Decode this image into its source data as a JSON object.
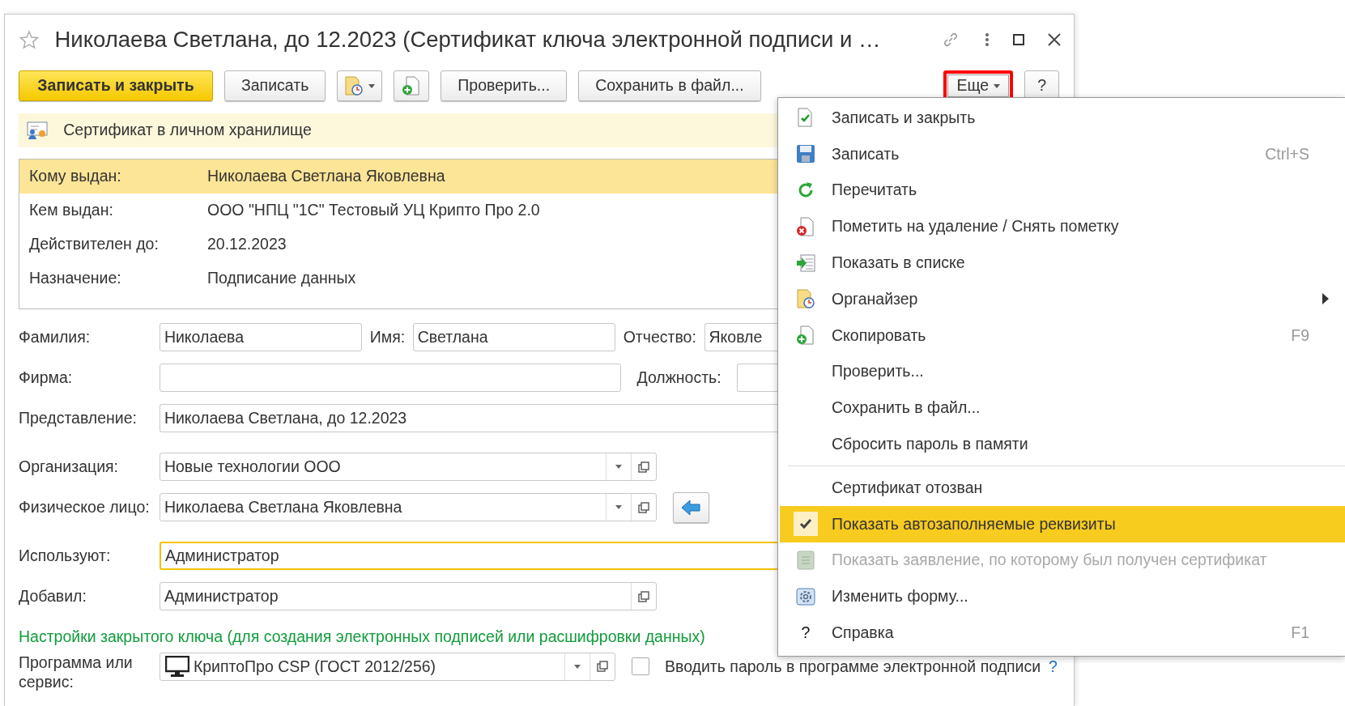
{
  "window": {
    "title": "Николаева Светлана, до 12.2023 (Сертификат ключа электронной подписи и …"
  },
  "toolbar": [
    {
      "kind": "primary",
      "label": "Записать и закрыть",
      "highlighted": false
    },
    {
      "kind": "text",
      "label": "Записать",
      "highlighted": false
    },
    {
      "kind": "organizer-dropdown",
      "highlighted": false
    },
    {
      "kind": "copy",
      "highlighted": false
    },
    {
      "kind": "text",
      "label": "Проверить...",
      "highlighted": false
    },
    {
      "kind": "text",
      "label": "Сохранить в файл...",
      "highlighted": false
    },
    {
      "kind": "more",
      "label": "Еще",
      "highlighted": true
    },
    {
      "kind": "text",
      "label": "?",
      "highlighted": false
    }
  ],
  "info_bar": {
    "text": "Сертификат в личном хранилище"
  },
  "certificate": [
    {
      "label": "Кому выдан:",
      "value": "Николаева Светлана Яковлевна",
      "selected": true
    },
    {
      "label": "Кем выдан:",
      "value": "ООО \"НПЦ \"1С\" Тестовый УЦ Крипто Про 2.0",
      "selected": false
    },
    {
      "label": "Действителен до:",
      "value": "20.12.2023",
      "selected": false
    },
    {
      "label": "Назначение:",
      "value": "Подписание данных",
      "selected": false
    }
  ],
  "form": [
    [
      {
        "label": "Фамилия:",
        "value": "Николаева"
      },
      {
        "label": "Имя:",
        "value": "Светлана"
      },
      {
        "label": "Отчество:",
        "value": "Яковле"
      }
    ],
    [
      {
        "label": "Фирма:"
      },
      {
        "label": "Должность:"
      }
    ],
    [
      {
        "label": "Представление:",
        "value": "Николаева Светлана, до 12.2023"
      }
    ],
    [
      {
        "label": "Организация:",
        "value": "Новые технологии ООО",
        "dropdown": true,
        "open_button": true
      }
    ],
    [
      {
        "label": "Физическое лицо:",
        "value": "Николаева Светлана Яковлевна",
        "dropdown": true,
        "open_button": true,
        "fill_button": true
      }
    ],
    [
      {
        "label": "Используют:",
        "value": "Администратор",
        "focused": true
      }
    ],
    [
      {
        "label": "Добавил:",
        "value": "Администратор",
        "open_button": true
      }
    ]
  ],
  "key_settings": {
    "heading": "Настройки закрытого ключа (для создания электронных подписей или расшифровки данных)",
    "program": {
      "label": "Программа или сервис:",
      "value": "КриптоПро CSP (ГОСТ 2012/256)",
      "dropdown": true,
      "open_button": true
    },
    "password_checkbox": {
      "label": "Вводить пароль в программе электронной подписи",
      "checked": false
    },
    "help": "?"
  },
  "menu": [
    {
      "label": "Записать и закрыть",
      "selected": false,
      "disabled": false
    },
    {
      "label": "Записать",
      "shortcut": "Ctrl+S",
      "selected": false,
      "disabled": false
    },
    {
      "label": "Перечитать",
      "selected": false,
      "disabled": false
    },
    {
      "label": "Пометить на удаление / Снять пометку",
      "selected": false,
      "disabled": false
    },
    {
      "label": "Показать в списке",
      "selected": false,
      "disabled": false
    },
    {
      "label": "Органайзер",
      "submenu": true,
      "selected": false,
      "disabled": false
    },
    {
      "label": "Скопировать",
      "shortcut": "F9",
      "selected": false,
      "disabled": false
    },
    {
      "label": "Проверить...",
      "selected": false,
      "disabled": false
    },
    {
      "label": "Сохранить в файл...",
      "selected": false,
      "disabled": false
    },
    {
      "label": "Сбросить пароль в памяти",
      "selected": false,
      "disabled": false
    },
    {
      "label": "Сертификат отозван",
      "separator_before": true,
      "checked": false,
      "selected": false,
      "disabled": false
    },
    {
      "label": "Показать автозаполняемые реквизиты",
      "checked": true,
      "selected": true,
      "disabled": false
    },
    {
      "label": "Показать заявление, по которому был получен сертификат",
      "selected": false,
      "disabled": true
    },
    {
      "label": "Изменить форму...",
      "selected": false,
      "disabled": false
    },
    {
      "label": "Справка",
      "icon_char": "?",
      "shortcut": "F1",
      "selected": false,
      "disabled": false
    }
  ]
}
